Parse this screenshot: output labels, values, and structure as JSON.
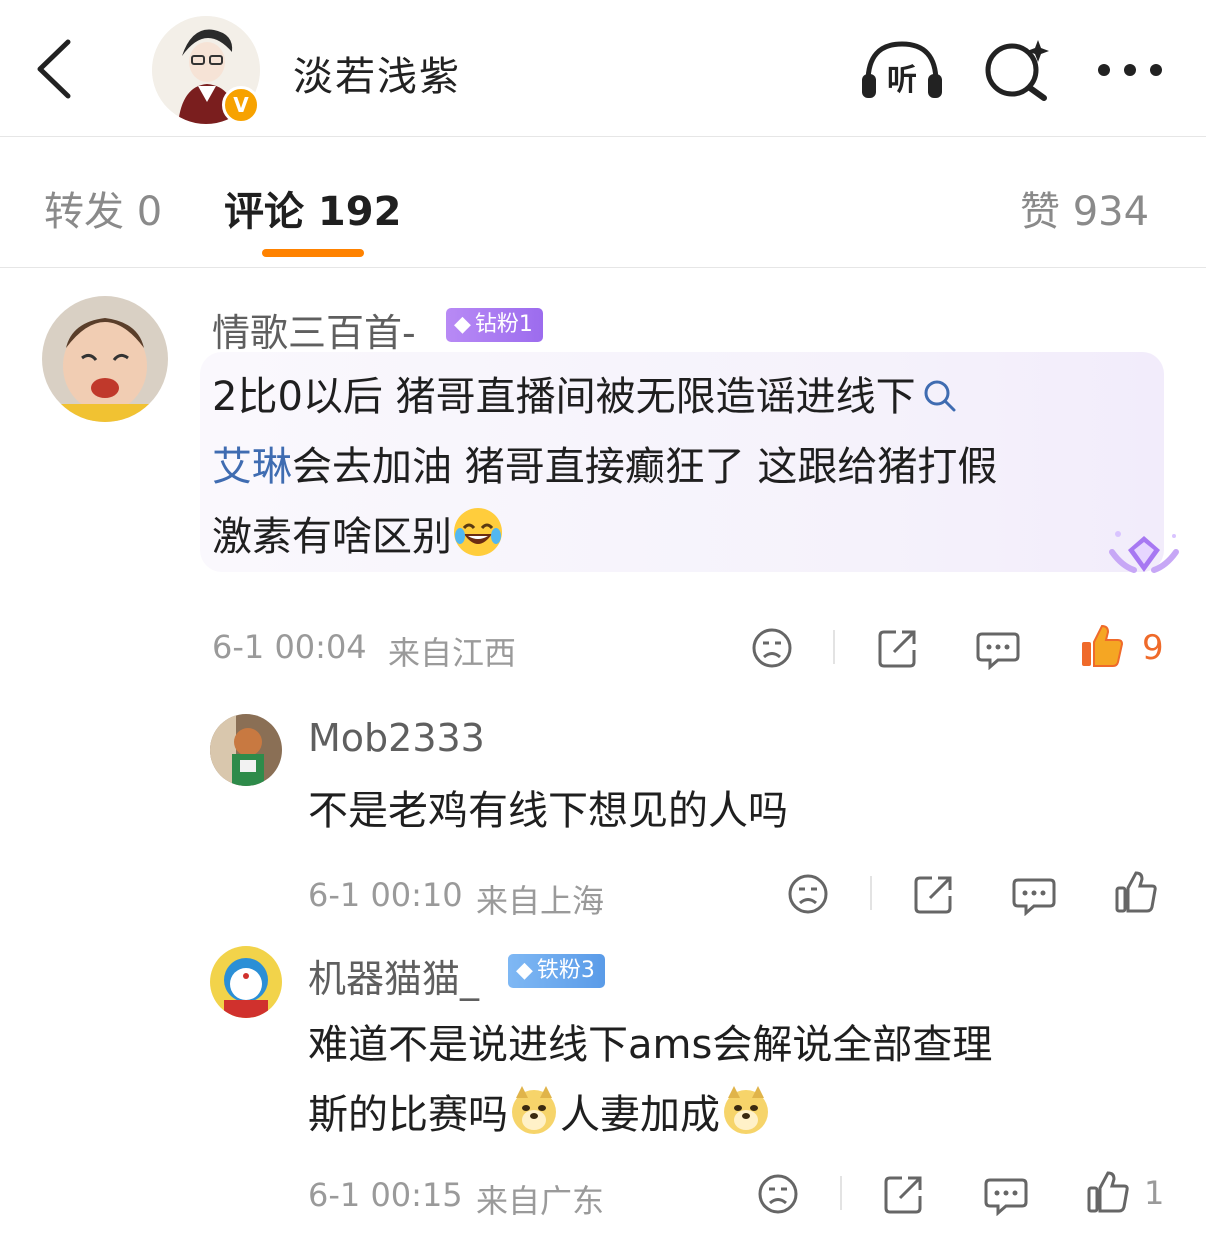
{
  "header": {
    "title": "淡若浅紫",
    "verified_badge": "V",
    "listen_label": "听"
  },
  "tabs": [
    {
      "label": "转发 0"
    },
    {
      "label": "评论 192"
    },
    {
      "label": "赞 934"
    }
  ],
  "comments": [
    {
      "username": "情歌三百首-",
      "badge": "钻粉1",
      "text_line1": "2比0以后 猪哥直播间被无限造谣进线下",
      "link_text": "艾琳",
      "text_line2": "会去加油 猪哥直接癫狂了 这跟给猪打假",
      "text_line3": "激素有啥区别",
      "emoji": "laughing-crying-emoji",
      "time": "6-1 00:04",
      "location": "来自江西",
      "likes": "9"
    },
    {
      "username": "Mob2333",
      "text_line1": "不是老鸡有线下想见的人吗",
      "time": "6-1 00:10",
      "location": "来自上海"
    },
    {
      "username": "机器猫猫_",
      "badge": "铁粉3",
      "text_line1": "难道不是说进线下ams会解说全部查理",
      "text_line2a": "斯的比赛吗",
      "text_line2b": "人妻加成",
      "emoji": "doge-emoji",
      "time": "6-1 00:15",
      "location": "来自广东",
      "likes": "1"
    }
  ],
  "colors": {
    "accent": "#ff8200",
    "link": "#3f6cb1",
    "like_active": "#ef6a2a",
    "diamond_badge": "#a77af0",
    "iron_badge": "#6aa8f0"
  }
}
